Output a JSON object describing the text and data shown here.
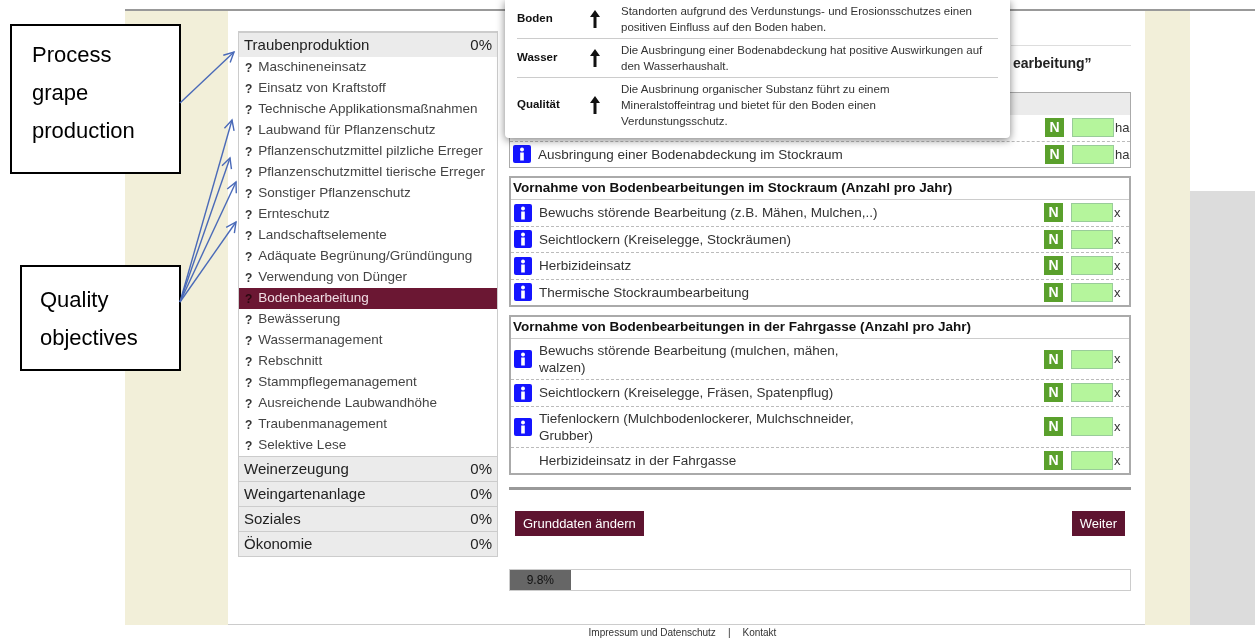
{
  "annotations": [
    {
      "text": "Process grape production"
    },
    {
      "text": "Quality objectives"
    }
  ],
  "sidebar": {
    "sections": [
      {
        "title": "Traubenproduktion",
        "percent": "0%",
        "items": [
          {
            "mark": "?",
            "label": "Maschineneinsatz",
            "selected": false
          },
          {
            "mark": "?",
            "label": "Einsatz von Kraftstoff",
            "selected": false
          },
          {
            "mark": "?",
            "label": "Technische Applikationsmaßnahmen",
            "selected": false
          },
          {
            "mark": "?",
            "label": "Laubwand für Pflanzenschutz",
            "selected": false
          },
          {
            "mark": "?",
            "label": "Pflanzenschutzmittel pilzliche Erreger",
            "selected": false
          },
          {
            "mark": "?",
            "label": "Pflanzenschutzmittel tierische Erreger",
            "selected": false
          },
          {
            "mark": "?",
            "label": "Sonstiger Pflanzenschutz",
            "selected": false
          },
          {
            "mark": "?",
            "label": "Ernteschutz",
            "selected": false
          },
          {
            "mark": "?",
            "label": "Landschaftselemente",
            "selected": false
          },
          {
            "mark": "?",
            "label": "Adäquate Begrünung/Gründüngung",
            "selected": false
          },
          {
            "mark": "?",
            "label": "Verwendung von Dünger",
            "selected": false
          },
          {
            "mark": "?",
            "label": "Bodenbearbeitung",
            "selected": true
          },
          {
            "mark": "?",
            "label": "Bewässerung",
            "selected": false
          },
          {
            "mark": "?",
            "label": "Wassermanagement",
            "selected": false
          },
          {
            "mark": "?",
            "label": "Rebschnitt",
            "selected": false
          },
          {
            "mark": "?",
            "label": "Stammpflegemanagement",
            "selected": false
          },
          {
            "mark": "?",
            "label": "Ausreichende Laubwandhöhe",
            "selected": false
          },
          {
            "mark": "?",
            "label": "Traubenmanagement",
            "selected": false
          },
          {
            "mark": "?",
            "label": "Selektive Lese",
            "selected": false
          }
        ]
      },
      {
        "title": "Weinerzeugung",
        "percent": "0%"
      },
      {
        "title": "Weingartenanlage",
        "percent": "0%"
      },
      {
        "title": "Soziales",
        "percent": "0%"
      },
      {
        "title": "Ökonomie",
        "percent": "0%"
      }
    ]
  },
  "content": {
    "heading_fragment": "earbeitung”",
    "sections": [
      {
        "rows": [
          {
            "badge": "N",
            "unit": "ha"
          },
          {
            "info": true,
            "label": "Ausbringung einer Bodenabdeckung im Stockraum",
            "badge": "N",
            "unit": "ha"
          }
        ]
      },
      {
        "title": "Vornahme von Bodenbearbeitungen im Stockraum (Anzahl pro Jahr)",
        "rows": [
          {
            "info": true,
            "label": "Bewuchs störende Bearbeitung (z.B. Mähen, Mulchen,..)",
            "badge": "N",
            "unit": "x"
          },
          {
            "info": true,
            "label": "Seichtlockern (Kreiselegge, Stockräumen)",
            "badge": "N",
            "unit": "x"
          },
          {
            "info": true,
            "label": "Herbizideinsatz",
            "badge": "N",
            "unit": "x"
          },
          {
            "info": true,
            "label": "Thermische Stockraumbearbeitung",
            "badge": "N",
            "unit": "x"
          }
        ]
      },
      {
        "title": "Vornahme von Bodenbearbeitungen in der Fahrgasse (Anzahl pro Jahr)",
        "rows": [
          {
            "info": true,
            "label": "Bewuchs störende Bearbeitung (mulchen, mähen, walzen)",
            "badge": "N",
            "unit": "x"
          },
          {
            "info": true,
            "label": "Seichtlockern (Kreiselegge, Fräsen, Spatenpflug)",
            "badge": "N",
            "unit": "x"
          },
          {
            "info": true,
            "label": "Tiefenlockern (Mulchbodenlockerer, Mulchschneider, Grubber)",
            "badge": "N",
            "unit": "x"
          },
          {
            "info": false,
            "label": "Herbizideinsatz in der Fahrgasse",
            "badge": "N",
            "unit": "x"
          }
        ]
      }
    ],
    "buttons": [
      {
        "label": "Grunddaten ändern"
      },
      {
        "label": "Weiter"
      }
    ],
    "progress": {
      "level": 0.098,
      "label": "9.8%"
    }
  },
  "popup": {
    "rows": [
      {
        "aspect": "Boden",
        "text": "Standorten aufgrund des Verdunstungs- und Erosionsschutzes einen positiven Einfluss auf den Boden haben."
      },
      {
        "aspect": "Wasser",
        "text": "Die Ausbringung einer Bodenabdeckung hat positive Auswirkungen auf den Wasserhaushalt."
      },
      {
        "aspect": "Qualität",
        "text": "Die Ausbrinung organischer Substanz führt zu einem Mineralstoffeintrag und bietet für den Boden einen Verdunstungsschutz."
      }
    ]
  },
  "footer": {
    "links": [
      "Impressum und Datenschutz",
      "Kontakt"
    ],
    "separator": "|"
  }
}
